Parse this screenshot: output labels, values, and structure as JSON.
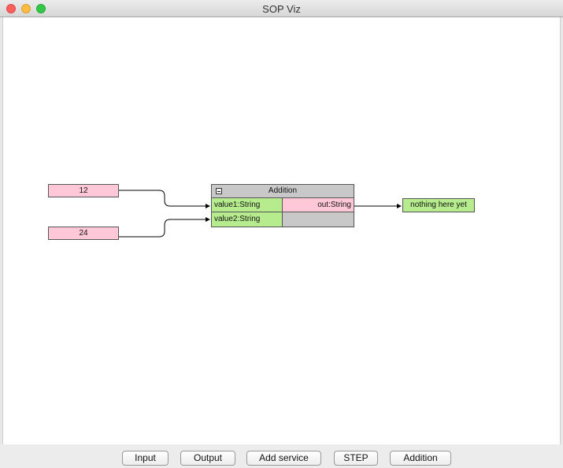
{
  "window": {
    "title": "SOP Viz"
  },
  "inputs": [
    {
      "value": "12"
    },
    {
      "value": "24"
    }
  ],
  "service": {
    "name": "Addition",
    "inputs": [
      {
        "label": "value1:String"
      },
      {
        "label": "value2:String"
      }
    ],
    "outputs": [
      {
        "label": "out:String"
      }
    ]
  },
  "output_node": {
    "value": "nothing here yet"
  },
  "toolbar": {
    "input_label": "Input",
    "output_label": "Output",
    "add_service_label": "Add service",
    "step_label": "STEP",
    "addition_label": "Addition"
  },
  "colors": {
    "input_node": "#ffc8d8",
    "port_in": "#b6ec8e",
    "service_body": "#c8c8c8"
  }
}
